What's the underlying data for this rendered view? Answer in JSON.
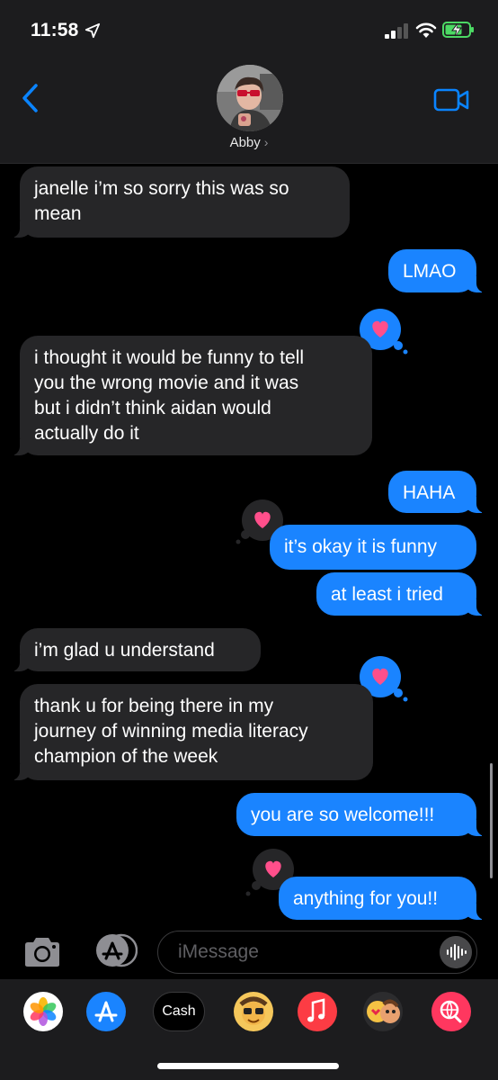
{
  "status_bar": {
    "time": "11:58",
    "icons": [
      "location-arrow-icon",
      "cellular-signal-icon",
      "wifi-icon",
      "battery-charging-icon"
    ]
  },
  "header": {
    "contact_name": "Abby",
    "name_chevron": "›",
    "back_icon": "chevron-left-icon",
    "video_icon": "video-camera-icon",
    "accent": "#0a84ff"
  },
  "messages": [
    {
      "direction": "incoming",
      "lines": [
        "janelle i’m so sorry this was so",
        "mean"
      ]
    },
    {
      "direction": "outgoing",
      "lines": [
        "LMAO"
      ],
      "reaction": "heart"
    },
    {
      "direction": "incoming",
      "lines": [
        "i thought it would be funny to tell",
        "you the wrong movie and it was",
        "but i didn’t think aidan would",
        "actually do it"
      ]
    },
    {
      "direction": "outgoing",
      "lines": [
        "HAHA"
      ],
      "reaction": "heart"
    },
    {
      "direction": "outgoing",
      "lines": [
        "it’s okay it is funny"
      ]
    },
    {
      "direction": "outgoing",
      "lines": [
        "at least i tried"
      ]
    },
    {
      "direction": "incoming",
      "lines": [
        "i’m glad u understand"
      ],
      "reaction": "heart"
    },
    {
      "direction": "incoming",
      "lines": [
        "thank u for being there in my",
        "journey of winning media literacy",
        "champion of the week"
      ]
    },
    {
      "direction": "outgoing",
      "lines": [
        "you are so welcome!!!"
      ],
      "reaction": "heart"
    },
    {
      "direction": "outgoing",
      "lines": [
        "anything for you!!"
      ]
    }
  ],
  "input_bar": {
    "placeholder": "iMessage",
    "camera_icon": "camera-icon",
    "apps_icon": "app-store-icon",
    "audio_icon": "audio-waveform-icon"
  },
  "app_drawer": {
    "apps": [
      "photos-icon",
      "app-store-icon",
      "apple-cash-icon",
      "memoji-icon",
      "music-icon",
      "animoji-stickers-icon",
      "web-search-icon"
    ],
    "cash_label": "Cash"
  },
  "colors": {
    "outgoing_bubble": "#1a84ff",
    "incoming_bubble": "#262628",
    "heart": "#ff4f8b",
    "background": "#000000"
  }
}
